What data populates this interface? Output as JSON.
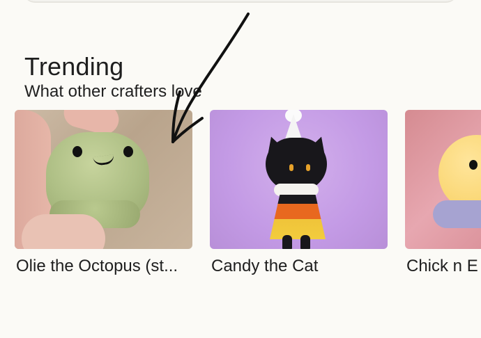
{
  "section": {
    "title": "Trending",
    "subtitle": "What other crafters love"
  },
  "cards": [
    {
      "name": "Olie the Octopus (st..."
    },
    {
      "name": "Candy the Cat"
    },
    {
      "name": "Chick n E"
    }
  ],
  "colors": {
    "background": "#fbfaf6",
    "text": "#1e1e1e",
    "annotation_stroke": "#111111"
  },
  "icons": {
    "annotation": "hand-drawn-arrow-icon"
  }
}
